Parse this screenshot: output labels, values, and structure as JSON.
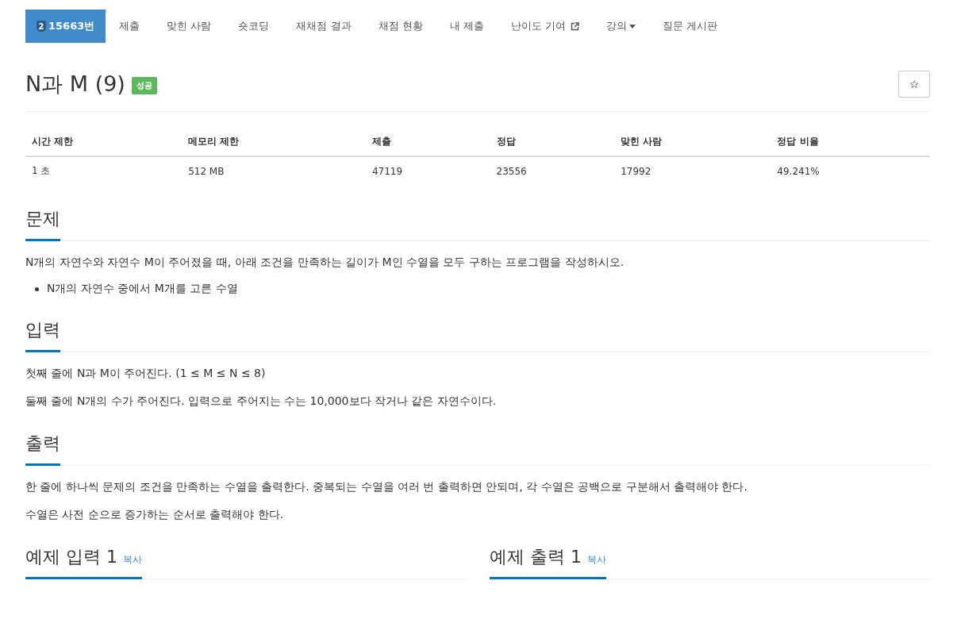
{
  "nav": {
    "items": [
      {
        "kind": "problem",
        "tier": "2",
        "label": "15663번",
        "selected": true
      },
      {
        "kind": "link",
        "label": "제출",
        "selected": false
      },
      {
        "kind": "link",
        "label": "맞힌 사람",
        "selected": false
      },
      {
        "kind": "link",
        "label": "숏코딩",
        "selected": false
      },
      {
        "kind": "link",
        "label": "재채점 결과",
        "selected": false
      },
      {
        "kind": "link",
        "label": "채점 현황",
        "selected": false
      },
      {
        "kind": "link",
        "label": "내 제출",
        "selected": false
      },
      {
        "kind": "external",
        "label": "난이도 기여",
        "selected": false
      },
      {
        "kind": "dropdown",
        "label": "강의",
        "selected": false
      },
      {
        "kind": "link",
        "label": "질문 게시판",
        "selected": false
      }
    ]
  },
  "problem": {
    "title": "N과 M (9)",
    "status": "성공",
    "star": "☆"
  },
  "info_table": {
    "columns": [
      "시간 제한",
      "메모리 제한",
      "제출",
      "정답",
      "맞힌 사람",
      "정답 비율"
    ],
    "rows": [
      [
        "1 초",
        "512 MB",
        "47119",
        "23556",
        "17992",
        "49.241%"
      ]
    ]
  },
  "sections": [
    {
      "heading": "문제",
      "paragraphs": [
        "N개의 자연수와 자연수 M이 주어졌을 때, 아래 조건을 만족하는 길이가 M인 수열을 모두 구하는 프로그램을 작성하시오."
      ],
      "bullets": [
        "N개의 자연수 중에서 M개를 고른 수열"
      ]
    },
    {
      "heading": "입력",
      "paragraphs": [
        "첫째 줄에 N과 M이 주어진다. (1 ≤ M ≤ N ≤ 8)",
        "둘째 줄에 N개의 수가 주어진다. 입력으로 주어지는 수는 10,000보다 작거나 같은 자연수이다."
      ]
    },
    {
      "heading": "출력",
      "paragraphs": [
        "한 줄에 하나씩 문제의 조건을 만족하는 수열을 출력한다. 중복되는 수열을 여러 번 출력하면 안되며, 각 수열은 공백으로 구분해서 출력해야 한다.",
        "수열은 사전 순으로 증가하는 순서로 출력해야 한다."
      ]
    }
  ],
  "examples": [
    {
      "heading": "예제 입력 1",
      "copy": "복사"
    },
    {
      "heading": "예제 출력 1",
      "copy": "복사"
    }
  ]
}
